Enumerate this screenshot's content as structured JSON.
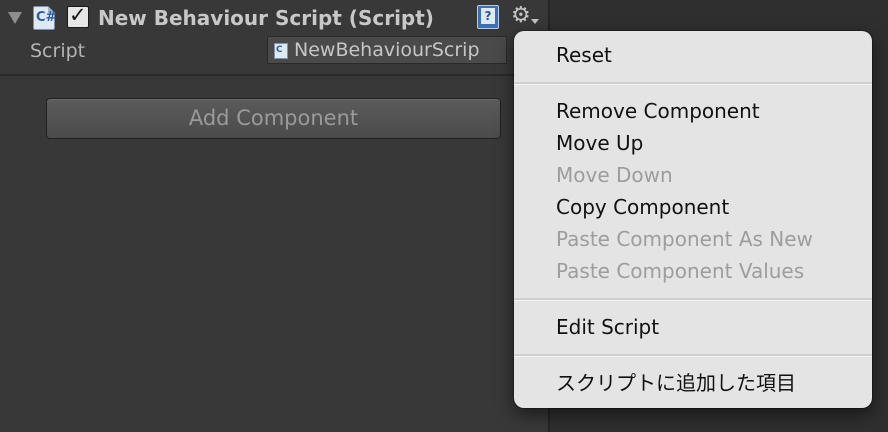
{
  "component": {
    "title": "New Behaviour Script (Script)",
    "enabled": true,
    "script_icon": "csharp-script-icon",
    "help_icon": "help-icon",
    "settings_icon": "gear-icon"
  },
  "script_field": {
    "label": "Script",
    "value": "NewBehaviourScrip"
  },
  "add_component": {
    "label": "Add Component"
  },
  "context_menu": {
    "reset": "Reset",
    "remove_component": "Remove Component",
    "move_up": "Move Up",
    "move_down": "Move Down",
    "copy_component": "Copy Component",
    "paste_as_new": "Paste Component As New",
    "paste_values": "Paste Component Values",
    "edit_script": "Edit Script",
    "added_item": "スクリプトに追加した項目"
  },
  "colors": {
    "panel_bg": "#383838",
    "menu_bg": "#e4e4e4",
    "menu_text": "#111111",
    "menu_disabled": "#9d9d9d",
    "accent_blue": "#3f6fb3"
  }
}
